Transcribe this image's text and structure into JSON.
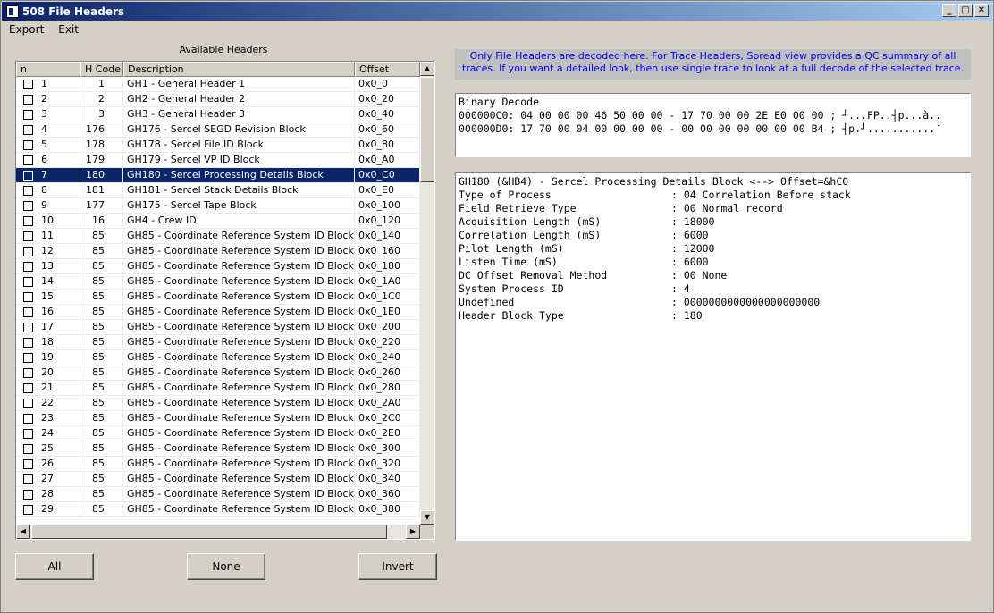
{
  "window": {
    "title": "508 File Headers"
  },
  "menu": [
    "Export",
    "Exit"
  ],
  "available_label": "Available Headers",
  "columns": [
    "n",
    "H Code",
    "Description",
    "Offset"
  ],
  "rows": [
    {
      "n": "1",
      "code": "1",
      "desc": "GH1 - General Header 1",
      "off": "0x0_0"
    },
    {
      "n": "2",
      "code": "2",
      "desc": "GH2 - General Header 2",
      "off": "0x0_20"
    },
    {
      "n": "3",
      "code": "3",
      "desc": "GH3 - General Header 3",
      "off": "0x0_40"
    },
    {
      "n": "4",
      "code": "176",
      "desc": "GH176 - Sercel SEGD Revision Block",
      "off": "0x0_60"
    },
    {
      "n": "5",
      "code": "178",
      "desc": "GH178 - Sercel File ID Block",
      "off": "0x0_80"
    },
    {
      "n": "6",
      "code": "179",
      "desc": "GH179 - Sercel VP ID Block",
      "off": "0x0_A0"
    },
    {
      "n": "7",
      "code": "180",
      "desc": "GH180 - Sercel Processing Details Block",
      "off": "0x0_C0"
    },
    {
      "n": "8",
      "code": "181",
      "desc": "GH181 - Sercel Stack Details Block",
      "off": "0x0_E0"
    },
    {
      "n": "9",
      "code": "177",
      "desc": "GH175 - Sercel Tape Block",
      "off": "0x0_100"
    },
    {
      "n": "10",
      "code": "16",
      "desc": "GH4 - Crew ID",
      "off": "0x0_120"
    },
    {
      "n": "11",
      "code": "85",
      "desc": "GH85 - Coordinate Reference System ID Block",
      "off": "0x0_140"
    },
    {
      "n": "12",
      "code": "85",
      "desc": "GH85 - Coordinate Reference System ID Block",
      "off": "0x0_160"
    },
    {
      "n": "13",
      "code": "85",
      "desc": "GH85 - Coordinate Reference System ID Block",
      "off": "0x0_180"
    },
    {
      "n": "14",
      "code": "85",
      "desc": "GH85 - Coordinate Reference System ID Block",
      "off": "0x0_1A0"
    },
    {
      "n": "15",
      "code": "85",
      "desc": "GH85 - Coordinate Reference System ID Block",
      "off": "0x0_1C0"
    },
    {
      "n": "16",
      "code": "85",
      "desc": "GH85 - Coordinate Reference System ID Block",
      "off": "0x0_1E0"
    },
    {
      "n": "17",
      "code": "85",
      "desc": "GH85 - Coordinate Reference System ID Block",
      "off": "0x0_200"
    },
    {
      "n": "18",
      "code": "85",
      "desc": "GH85 - Coordinate Reference System ID Block",
      "off": "0x0_220"
    },
    {
      "n": "19",
      "code": "85",
      "desc": "GH85 - Coordinate Reference System ID Block",
      "off": "0x0_240"
    },
    {
      "n": "20",
      "code": "85",
      "desc": "GH85 - Coordinate Reference System ID Block",
      "off": "0x0_260"
    },
    {
      "n": "21",
      "code": "85",
      "desc": "GH85 - Coordinate Reference System ID Block",
      "off": "0x0_280"
    },
    {
      "n": "22",
      "code": "85",
      "desc": "GH85 - Coordinate Reference System ID Block",
      "off": "0x0_2A0"
    },
    {
      "n": "23",
      "code": "85",
      "desc": "GH85 - Coordinate Reference System ID Block",
      "off": "0x0_2C0"
    },
    {
      "n": "24",
      "code": "85",
      "desc": "GH85 - Coordinate Reference System ID Block",
      "off": "0x0_2E0"
    },
    {
      "n": "25",
      "code": "85",
      "desc": "GH85 - Coordinate Reference System ID Block",
      "off": "0x0_300"
    },
    {
      "n": "26",
      "code": "85",
      "desc": "GH85 - Coordinate Reference System ID Block",
      "off": "0x0_320"
    },
    {
      "n": "27",
      "code": "85",
      "desc": "GH85 - Coordinate Reference System ID Block",
      "off": "0x0_340"
    },
    {
      "n": "28",
      "code": "85",
      "desc": "GH85 - Coordinate Reference System ID Block",
      "off": "0x0_360"
    },
    {
      "n": "29",
      "code": "85",
      "desc": "GH85 - Coordinate Reference System ID Block",
      "off": "0x0_380"
    }
  ],
  "selected_row": "7",
  "buttons": {
    "all": "All",
    "none": "None",
    "invert": "Invert"
  },
  "info_text": "Only File Headers are decoded here. For Trace Headers, Spread view provides a QC summary of all traces. If you want a detailed look, then use single trace to look at a full decode of the selected trace.",
  "binary": {
    "title": "Binary Decode",
    "lines": [
      "000000C0: 04 00 00 00 46 50 00 00 - 17 70 00 00 2E E0 00 00 ; ┘...FP..┤p...à..",
      "000000D0: 17 70 00 04 00 00 00 00 - 00 00 00 00 00 00 00 B4 ; ┤p.┘...........´"
    ]
  },
  "decode": {
    "title": "GH180 (&HB4) - Sercel Processing Details Block <--> Offset=&hC0",
    "fields": [
      {
        "k": "Type of Process",
        "v": ": 04 Correlation Before stack"
      },
      {
        "k": "Field Retrieve Type",
        "v": ": 00 Normal record"
      },
      {
        "k": "Acquisition Length (mS)",
        "v": ": 18000"
      },
      {
        "k": "Correlation Length (mS)",
        "v": ": 6000"
      },
      {
        "k": "Pilot Length (mS)",
        "v": ": 12000"
      },
      {
        "k": "Listen Time (mS)",
        "v": ": 6000"
      },
      {
        "k": "DC Offset Removal Method",
        "v": ": 00 None"
      },
      {
        "k": "System Process ID",
        "v": ": 4"
      },
      {
        "k": "Undefined",
        "v": ": 0000000000000000000000"
      },
      {
        "k": "Header Block Type",
        "v": ": 180"
      }
    ]
  },
  "colors": {
    "selection": "#0a246a",
    "info_text": "#0000ee",
    "info_bg": "#c0c0c0"
  }
}
